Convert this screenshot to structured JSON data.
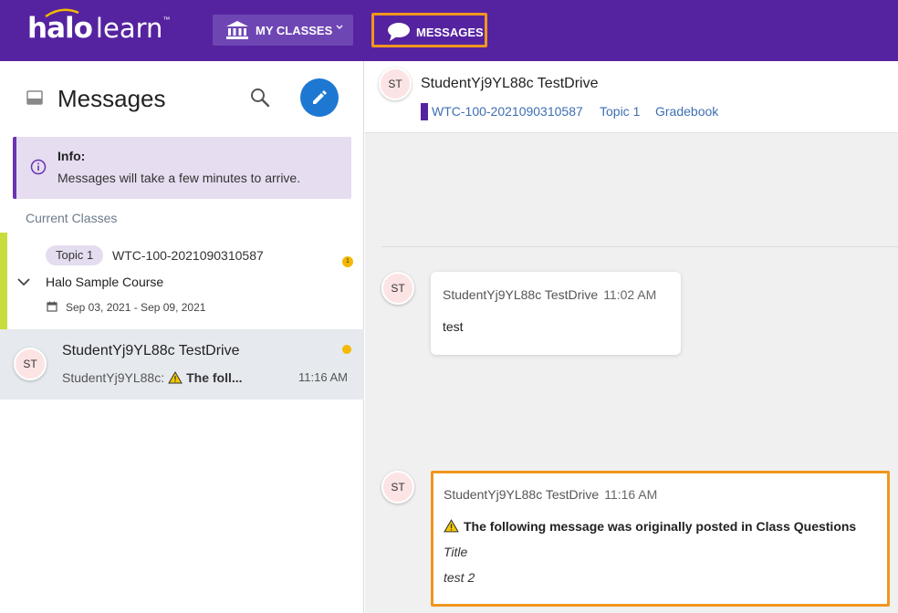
{
  "app": {
    "logo_brand": "halo",
    "logo_product": "learn",
    "logo_tm": "™",
    "nav": {
      "classes_label": "MY CLASSES",
      "messages_label": "MESSAGES"
    }
  },
  "sidebar": {
    "title": "Messages",
    "info": {
      "title": "Info:",
      "text": "Messages will take a few minutes to arrive."
    },
    "section_label": "Current Classes",
    "class_item": {
      "topic_chip": "Topic 1",
      "code": "WTC-100-2021090310587",
      "course": "Halo Sample Course",
      "dates": "Sep 03, 2021 - Sep 09, 2021",
      "badge_count": "1"
    },
    "thread": {
      "avatar": "ST",
      "name": "StudentYj9YL88c TestDrive",
      "preview_sender": "StudentYj9YL88c:",
      "preview_text": "The foll...",
      "time": "11:16 AM"
    }
  },
  "conversation": {
    "avatar": "ST",
    "name": "StudentYj9YL88c TestDrive",
    "breadcrumbs": [
      "WTC-100-2021090310587",
      "Topic 1",
      "Gradebook"
    ],
    "messages": [
      {
        "avatar": "ST",
        "sender": "StudentYj9YL88c TestDrive",
        "time": "11:02 AM",
        "body": "test"
      },
      {
        "avatar": "ST",
        "sender": "StudentYj9YL88c TestDrive",
        "time": "11:16 AM",
        "notice": "The following message was originally posted in Class Questions",
        "title": "Title",
        "body": "test 2"
      }
    ]
  },
  "colors": {
    "brand_purple": "#5523a0",
    "highlight_orange": "#f0961e",
    "compose_blue": "#1e78d2",
    "class_stripe": "#c8dc3c",
    "unread_yellow": "#f5b800"
  },
  "icons": [
    "bank-icon",
    "chat-bubble-icon",
    "inbox-icon",
    "search-icon",
    "pencil-icon",
    "info-icon",
    "chevron-down-icon",
    "calendar-icon",
    "warning-icon"
  ]
}
